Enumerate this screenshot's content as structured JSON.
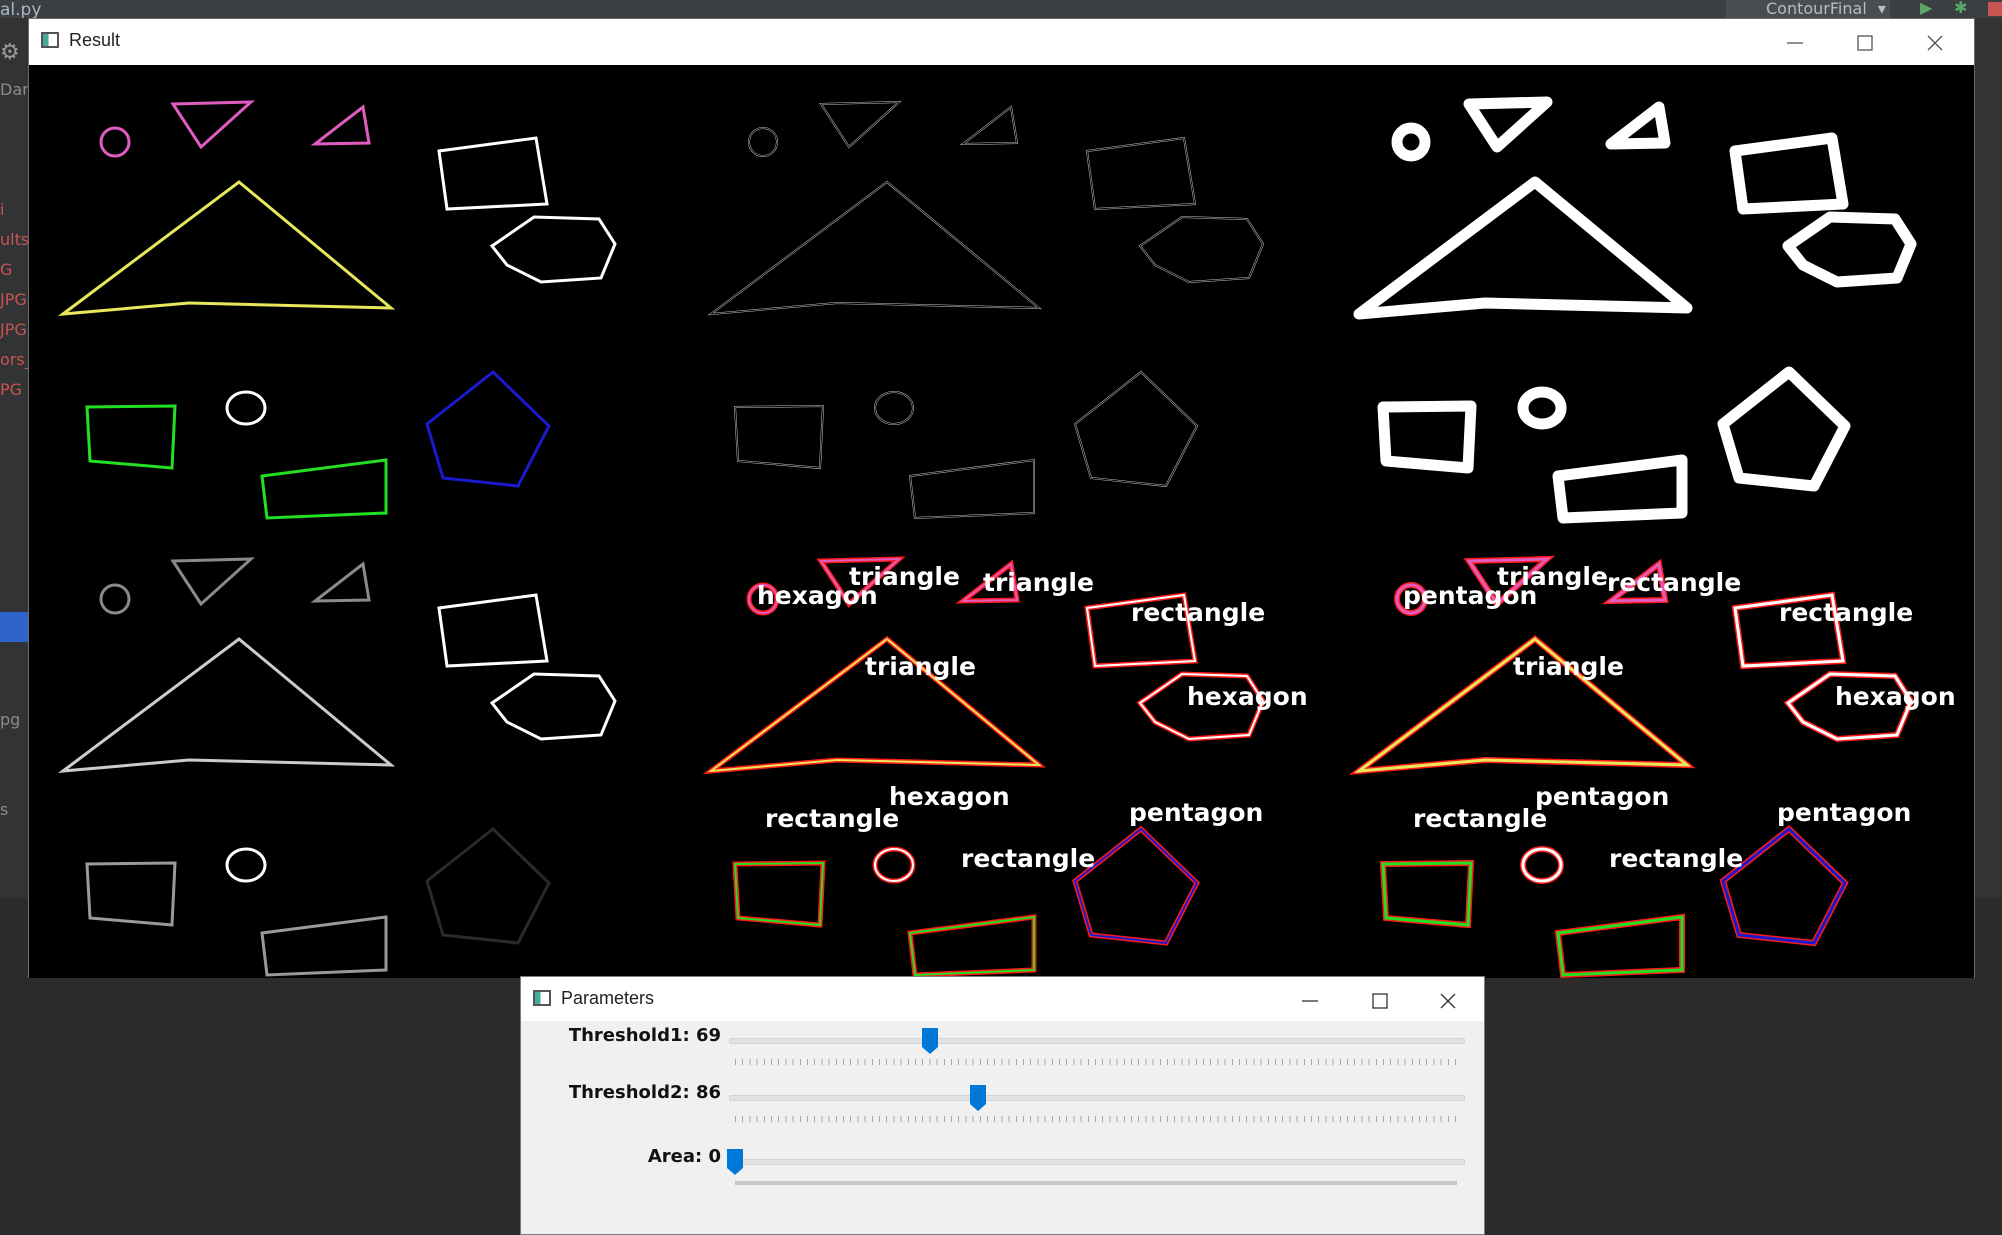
{
  "ide": {
    "file_tab": "al.py",
    "run_config": "ContourFinal",
    "left_items": [
      "Dan",
      "i",
      "ults",
      "G",
      "JPG",
      "JPG",
      "ors_",
      "PG",
      "pg",
      "s"
    ]
  },
  "result_window": {
    "title": "Result",
    "shape_labels": {
      "contour_panel": [
        "hexagon",
        "triangle",
        "triangle",
        "rectangle",
        "triangle",
        "hexagon",
        "hexagon",
        "rectangle",
        "pentagon",
        "rectangle"
      ],
      "dilated_panel": [
        "pentagon",
        "triangle",
        "rectangle",
        "rectangle",
        "triangle",
        "hexagon",
        "pentagon",
        "rectangle",
        "pentagon",
        "rectangle"
      ]
    }
  },
  "parameters_window": {
    "title": "Parameters",
    "sliders": [
      {
        "label": "Threshold1: 69",
        "value": 69,
        "max": 255,
        "ticks": true
      },
      {
        "label": "Threshold2: 86",
        "value": 86,
        "max": 255,
        "ticks": true
      },
      {
        "label": "Area: 0",
        "value": 0,
        "max": 30000,
        "ticks": false
      }
    ]
  },
  "colors": {
    "accent": "#0078d7",
    "pink": "#e05cc0",
    "yellow": "#e8e85a",
    "green": "#22e022",
    "blue": "#1a1acc",
    "red": "#ff1a1a"
  },
  "icons": [
    "settings-icon",
    "minimize-icon",
    "maximize-icon",
    "close-icon",
    "app-icon",
    "run-icon",
    "debug-icon",
    "stop-icon",
    "dropdown-icon"
  ]
}
